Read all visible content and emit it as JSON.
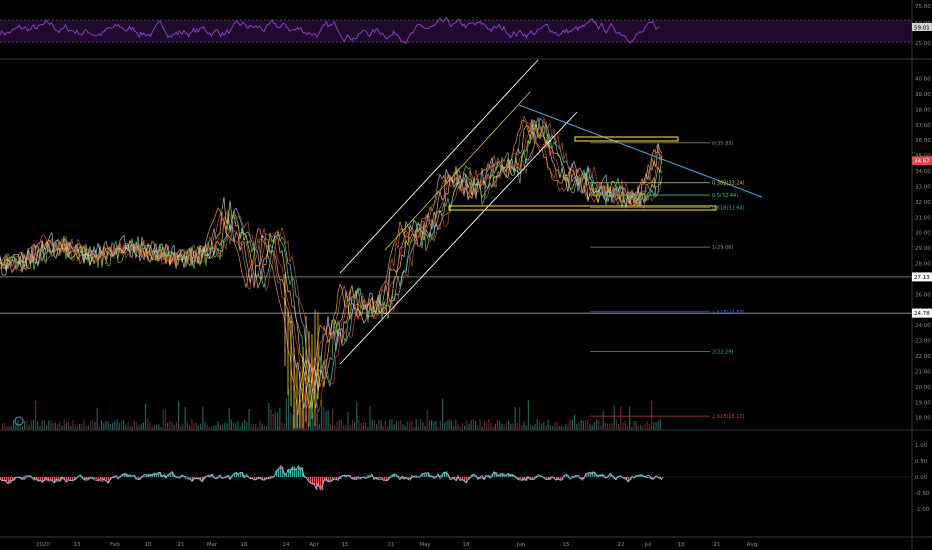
{
  "chart_data": [
    {
      "type": "line",
      "panel": "rsi",
      "y_ticks": [
        "75.00",
        "50.00",
        "25.00"
      ],
      "last_value_label": "59.01",
      "band": {
        "upper": 70,
        "lower": 30
      },
      "ylim": [
        20,
        80
      ],
      "colors": {
        "line": "#9b3bd6",
        "band_fill": "#1e0a2e",
        "band_line": "#8a8a8a"
      }
    },
    {
      "type": "line",
      "panel": "price",
      "y_ticks": [
        "40.00",
        "39.00",
        "38.00",
        "37.00",
        "36.00",
        "35.00",
        "34.00",
        "33.00",
        "32.00",
        "31.00",
        "30.00",
        "29.00",
        "28.00",
        "27.00",
        "26.00",
        "25.00",
        "24.00",
        "23.00",
        "22.00",
        "21.00",
        "20.00",
        "19.00",
        "18.00"
      ],
      "ylim": [
        17.2,
        41.2
      ],
      "price_labels": [
        {
          "text": "34.67",
          "value": 34.67,
          "bg": "#e0454f"
        },
        {
          "text": "27.13",
          "value": 27.13,
          "bg": "#ffffff"
        },
        {
          "text": "24.78",
          "value": 24.78,
          "bg": "#ffffff"
        }
      ],
      "horizontal_lines": [
        27.13,
        24.78
      ],
      "fib_levels": [
        {
          "label": "0(35.83)",
          "value": 35.83,
          "color": "#7d7d7d"
        },
        {
          "label": "0.382(33.24)",
          "value": 33.24,
          "color": "#d8c23a"
        },
        {
          "label": "0.5(32.44)",
          "value": 32.44,
          "color": "#37c46b"
        },
        {
          "label": "0.618(31.64)",
          "value": 31.64,
          "color": "#3aa1a3"
        },
        {
          "label": "1(29.06)",
          "value": 29.06,
          "color": "#8a8a8a"
        },
        {
          "label": "1.618(24.87)",
          "value": 24.87,
          "color": "#3a5fd8"
        },
        {
          "label": "2(22.29)",
          "value": 22.29,
          "color": "#2fa86a"
        },
        {
          "label": "2.618(18.10)",
          "value": 18.1,
          "color": "#d0382f"
        }
      ],
      "colors": {
        "channel": "#ffffff",
        "trendline": "#4aa3d8",
        "zone": "#f2d43a"
      }
    },
    {
      "type": "bar",
      "panel": "oscillator",
      "y_ticks": [
        "1.00",
        "0.50",
        "0.00",
        "-0.50",
        "-1.00"
      ],
      "ylim": [
        -1.5,
        1.5
      ],
      "colors": {
        "pos": "#26a69a",
        "neg": "#ef5350",
        "line1": "#4aa3d8",
        "line2": "#c0c0c0"
      }
    },
    {
      "type": "axis",
      "panel": "time",
      "x_ticks": [
        "2020",
        "13",
        "Feb",
        "10",
        "21",
        "Mar",
        "16",
        "24",
        "Apr",
        "15",
        "21",
        "May",
        "18",
        "Jun",
        "15",
        "22",
        "Jul",
        "13",
        "21",
        "Aug"
      ]
    }
  ]
}
